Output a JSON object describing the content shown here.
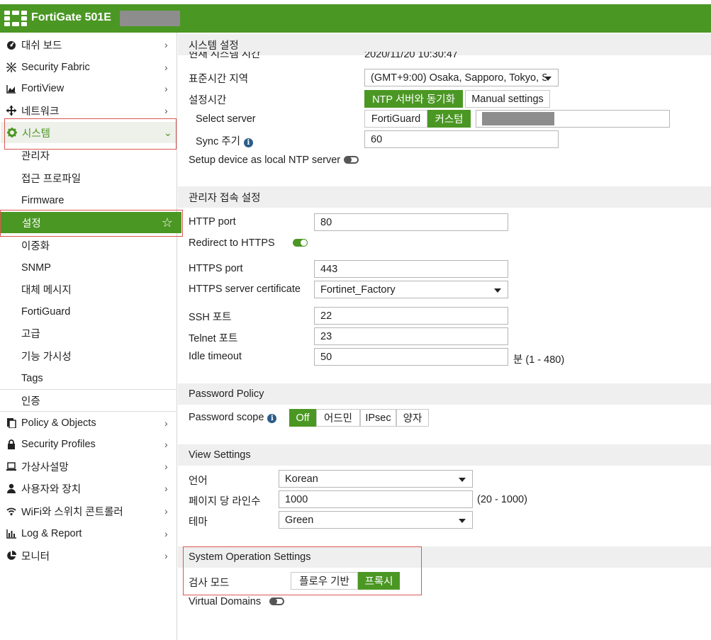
{
  "header": {
    "brand": "FortiGate 501E"
  },
  "sidebar": {
    "top_items": [
      {
        "label": "대쉬 보드",
        "icon": "dashboard-icon"
      },
      {
        "label": "Security Fabric",
        "icon": "fabric-icon"
      },
      {
        "label": "FortiView",
        "icon": "chart-icon"
      },
      {
        "label": "네트워크",
        "icon": "network-icon"
      },
      {
        "label": "시스템",
        "icon": "gear-icon"
      }
    ],
    "system_sub": [
      "관리자",
      "접근 프로파일",
      "Firmware",
      "설정",
      "이중화",
      "SNMP",
      "대체 메시지",
      "FortiGuard",
      "고급",
      "기능 가시성",
      "Tags",
      "인증"
    ],
    "bottom_items": [
      {
        "label": "Policy & Objects",
        "icon": "policy-icon"
      },
      {
        "label": "Security Profiles",
        "icon": "lock-icon"
      },
      {
        "label": "가상사설망",
        "icon": "laptop-icon"
      },
      {
        "label": "사용자와 장치",
        "icon": "user-icon"
      },
      {
        "label": "WiFi와 스위치 콘트롤러",
        "icon": "wifi-icon"
      },
      {
        "label": "Log & Report",
        "icon": "bar-chart-icon"
      },
      {
        "label": "모니터",
        "icon": "pie-chart-icon"
      }
    ],
    "star": "☆"
  },
  "system": {
    "title": "시스템 설정",
    "current_time_label": "현재 시스템 시간",
    "current_time_value": "2020/11/20 10:30:47",
    "timezone_label": "표준시간 지역",
    "timezone_value": "(GMT+9:00) Osaka, Sapporo, Tokyo, S",
    "set_time_label": "설정시간",
    "ntp_option": "NTP 서버와 동기화",
    "manual_option": "Manual settings",
    "select_server_label": "Select server",
    "fortiguard_option": "FortiGuard",
    "custom_option": "커스텀",
    "sync_label": "Sync 주기",
    "sync_value": "60",
    "local_ntp_label": "Setup device as local NTP server"
  },
  "admin": {
    "title": "관리자 접속 설정",
    "http_label": "HTTP port",
    "http_value": "80",
    "redirect_label": "Redirect to HTTPS",
    "https_label": "HTTPS port",
    "https_value": "443",
    "cert_label": "HTTPS server certificate",
    "cert_value": "Fortinet_Factory",
    "ssh_label": "SSH 포트",
    "ssh_value": "22",
    "telnet_label": "Telnet 포트",
    "telnet_value": "23",
    "idle_label": "Idle timeout",
    "idle_value": "50",
    "idle_hint": "분 (1 - 480)"
  },
  "password": {
    "title": "Password Policy",
    "scope_label": "Password scope",
    "options": [
      "Off",
      "어드민",
      "IPsec",
      "양자"
    ]
  },
  "view": {
    "title": "View Settings",
    "lang_label": "언어",
    "lang_value": "Korean",
    "lines_label": "페이지 당 라인수",
    "lines_value": "1000",
    "lines_hint": "(20 - 1000)",
    "theme_label": "테마",
    "theme_value": "Green"
  },
  "operation": {
    "title": "System Operation Settings",
    "mode_label": "검사 모드",
    "flow_option": "플로우 기반",
    "proxy_option": "프록시",
    "vdom_label": "Virtual Domains"
  },
  "colors": {
    "brand_green": "#4b9724",
    "highlight_red": "#d9584f"
  }
}
